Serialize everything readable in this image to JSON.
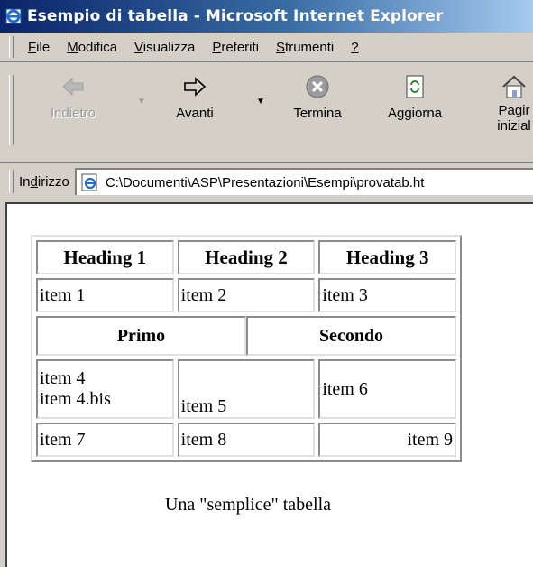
{
  "window": {
    "title": "Esempio di tabella - Microsoft Internet Explorer"
  },
  "menu": {
    "items": [
      {
        "label_u": "F",
        "label_rest": "ile"
      },
      {
        "label_u": "M",
        "label_rest": "odifica"
      },
      {
        "label_u": "V",
        "label_rest": "isualizza"
      },
      {
        "label_u": "P",
        "label_rest": "referiti"
      },
      {
        "label_u": "S",
        "label_rest": "trumenti"
      },
      {
        "label_u": "?",
        "label_rest": ""
      }
    ]
  },
  "toolbar": {
    "back_label": "Indietro",
    "forward_label": "Avanti",
    "stop_label": "Termina",
    "refresh_label": "Aggiorna",
    "home_label_1": "Pagir",
    "home_label_2": "inizial"
  },
  "address": {
    "label_pre": "In",
    "label_u": "d",
    "label_post": "irizzo",
    "value": "C:\\Documenti\\ASP\\Presentazioni\\Esempi\\provatab.ht"
  },
  "table": {
    "headings": [
      "Heading 1",
      "Heading 2",
      "Heading 3"
    ],
    "row1": [
      "item 1",
      "item 2",
      "item 3"
    ],
    "merged": [
      "Primo",
      "Secondo"
    ],
    "row3": {
      "c1_line1": "item 4",
      "c1_line2": "item 4.bis",
      "c2": "item 5",
      "c3": "item 6"
    },
    "row4": [
      "item 7",
      "item 8",
      "item 9"
    ]
  },
  "caption": "Una \"semplice\" tabella",
  "colors": {
    "titlebar_start": "#0a246a",
    "titlebar_end": "#a6caf0",
    "chrome": "#d4d0c8"
  },
  "icons": [
    "ie-logo-icon",
    "back-arrow-icon",
    "forward-arrow-icon",
    "stop-icon",
    "refresh-icon",
    "home-icon",
    "page-icon"
  ]
}
